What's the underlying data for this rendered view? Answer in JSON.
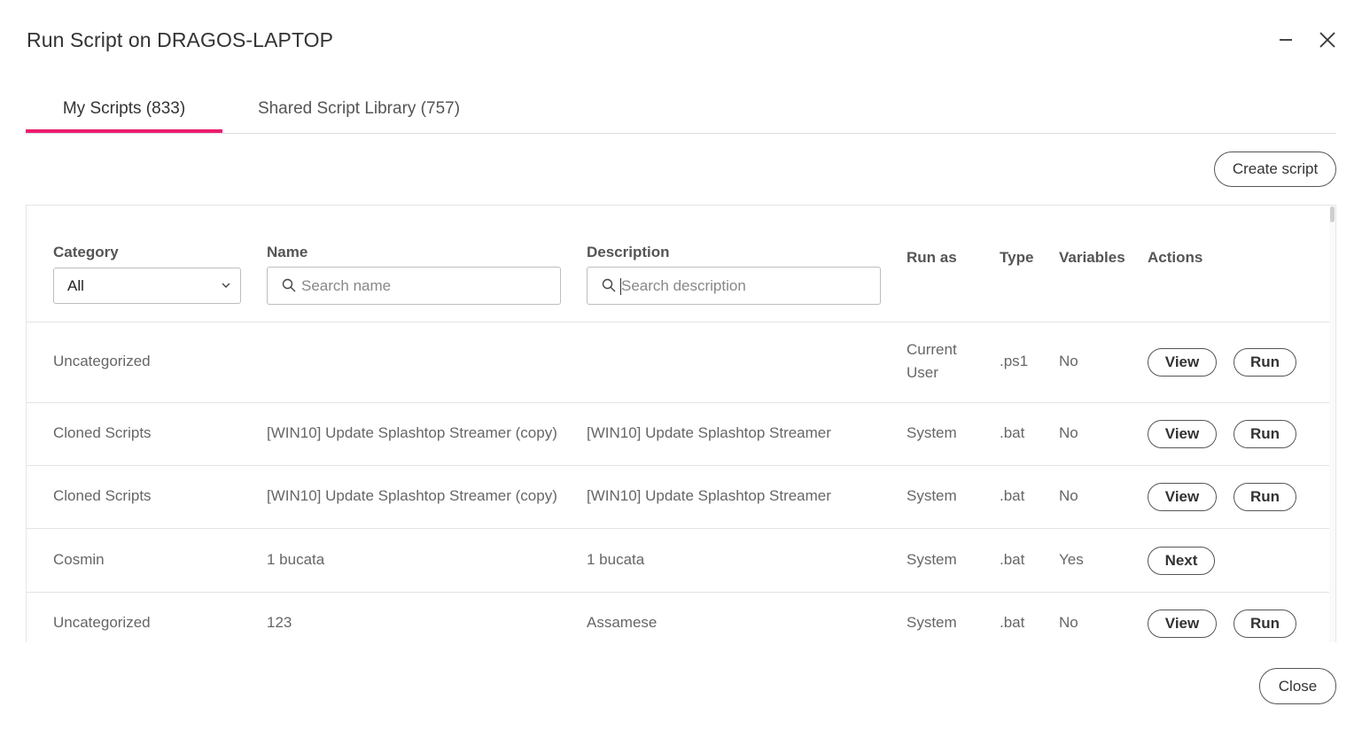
{
  "dialog": {
    "title": "Run Script on DRAGOS-LAPTOP",
    "minimize_icon": "minimize-icon",
    "close_icon": "close-icon"
  },
  "tabs": [
    {
      "label": "My Scripts (833)",
      "active": true
    },
    {
      "label": "Shared Script Library (757)",
      "active": false
    }
  ],
  "accent_color": "#ec1c6f",
  "toolbar": {
    "create_label": "Create script"
  },
  "table": {
    "headers": {
      "category": "Category",
      "name": "Name",
      "description": "Description",
      "run_as": "Run as",
      "type": "Type",
      "variables": "Variables",
      "actions": "Actions"
    },
    "filters": {
      "category_value": "All",
      "name_placeholder": "Search name",
      "description_placeholder": "Search description"
    },
    "rows": [
      {
        "category": "Uncategorized",
        "name": "",
        "description": "",
        "run_as": "Current User",
        "type": ".ps1",
        "variables": "No",
        "actions": [
          "View",
          "Run"
        ]
      },
      {
        "category": "Cloned Scripts",
        "name": "[WIN10] Update Splashtop Streamer (copy)",
        "description": "[WIN10] Update Splashtop Streamer",
        "run_as": "System",
        "type": ".bat",
        "variables": "No",
        "actions": [
          "View",
          "Run"
        ]
      },
      {
        "category": "Cloned Scripts",
        "name": "[WIN10] Update Splashtop Streamer (copy)",
        "description": "[WIN10] Update Splashtop Streamer",
        "run_as": "System",
        "type": ".bat",
        "variables": "No",
        "actions": [
          "View",
          "Run"
        ]
      },
      {
        "category": "Cosmin",
        "name": "1 bucata",
        "description": "1 bucata",
        "run_as": "System",
        "type": ".bat",
        "variables": "Yes",
        "actions": [
          "Next"
        ]
      },
      {
        "category": "Uncategorized",
        "name": "123",
        "description": "Assamese",
        "run_as": "System",
        "type": ".bat",
        "variables": "No",
        "actions": [
          "View",
          "Run"
        ]
      }
    ]
  },
  "footer": {
    "close_label": "Close"
  }
}
